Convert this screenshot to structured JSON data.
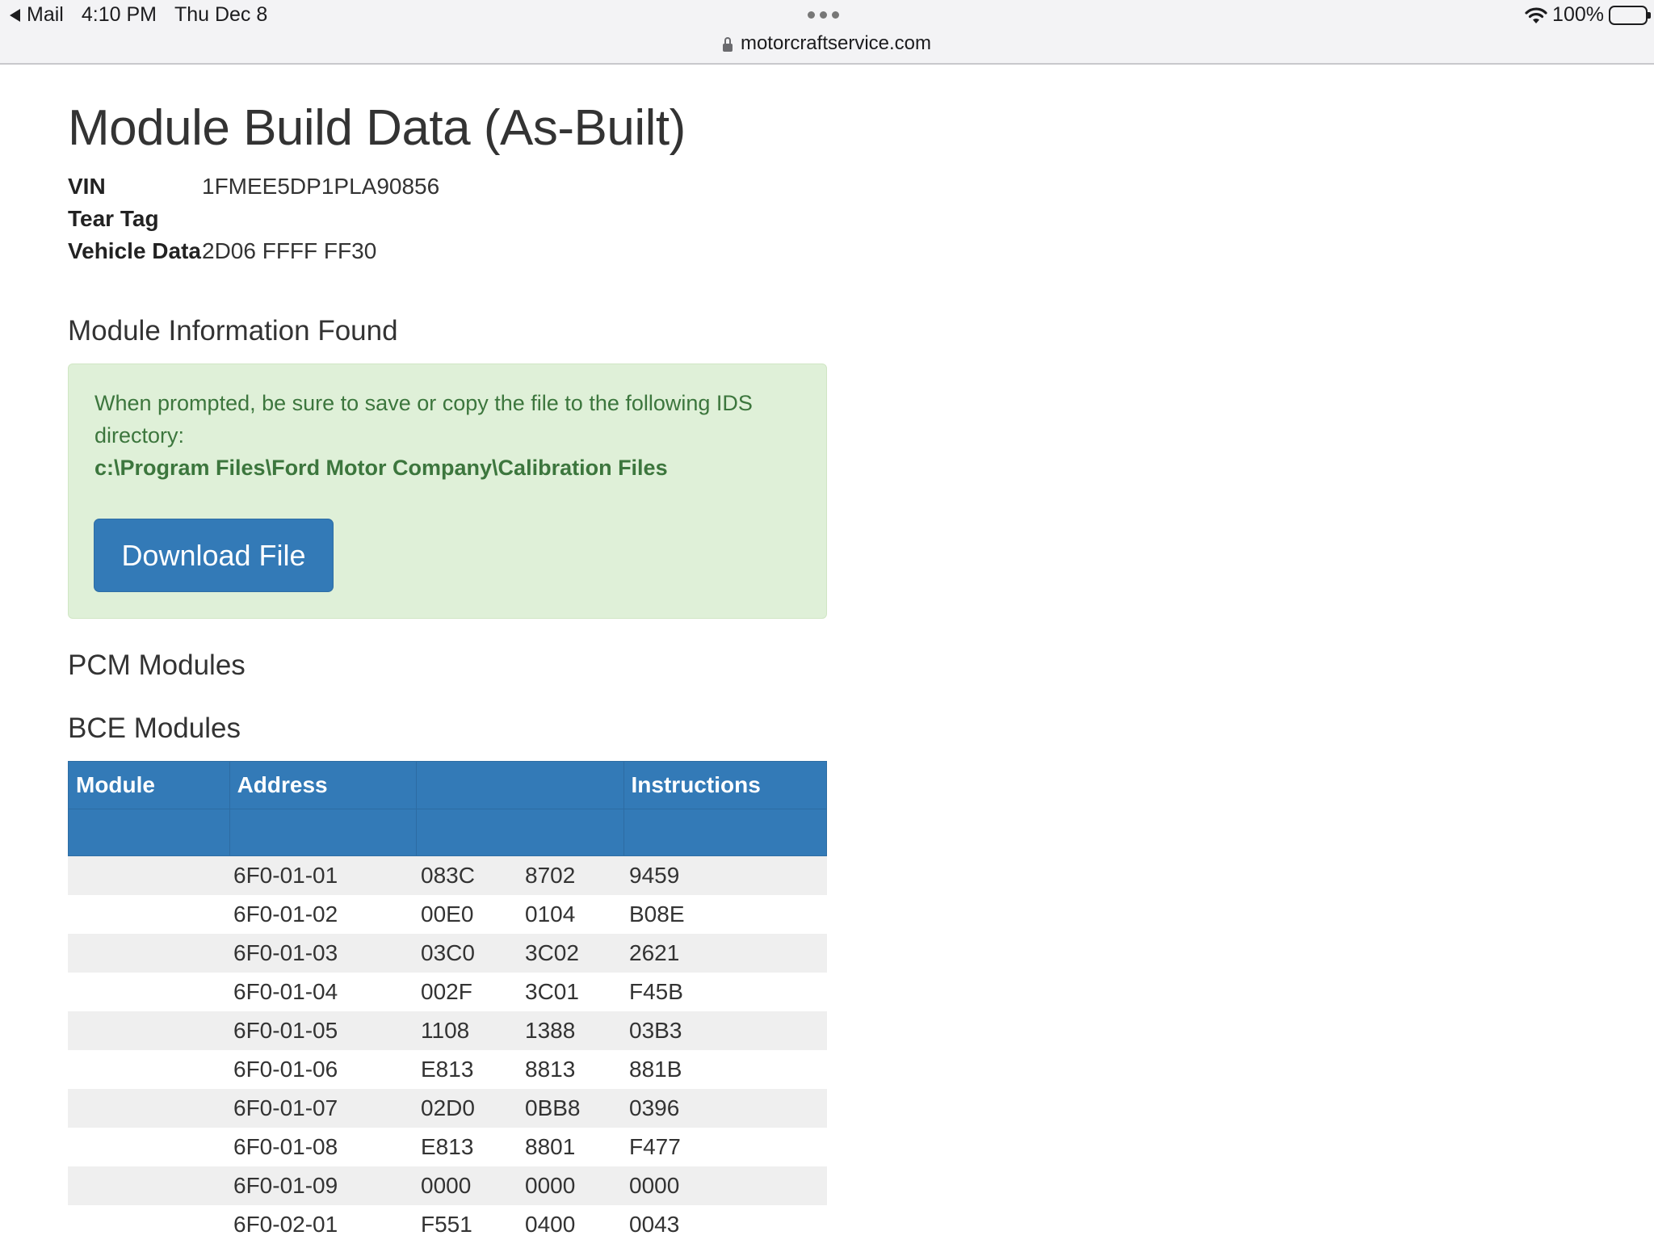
{
  "status_bar": {
    "back_app": "Mail",
    "time": "4:10 PM",
    "date": "Thu Dec 8",
    "battery": "100%",
    "url": "motorcraftservice.com"
  },
  "page": {
    "title": "Module Build Data (As-Built)",
    "vin_label": "VIN",
    "vin_value": "1FMEE5DP1PLA90856",
    "tear_tag_label": "Tear Tag",
    "tear_tag_value": "",
    "vehicle_data_label": "Vehicle Data",
    "vehicle_data_value": "2D06 FFFF FF30"
  },
  "found": {
    "heading": "Module Information Found",
    "message": "When prompted, be sure to save or copy the file to the following IDS directory:",
    "path": "c:\\Program Files\\Ford Motor Company\\Calibration Files",
    "download_label": "Download File"
  },
  "sections": {
    "pcm_heading": "PCM Modules",
    "bce_heading": "BCE Modules"
  },
  "table": {
    "headers": [
      "Module",
      "Address",
      "",
      "Instructions"
    ],
    "rows": [
      {
        "module": "",
        "address": "6F0-01-01",
        "d1": "083C",
        "d2": "8702",
        "d3": "9459"
      },
      {
        "module": "",
        "address": "6F0-01-02",
        "d1": "00E0",
        "d2": "0104",
        "d3": "B08E"
      },
      {
        "module": "",
        "address": "6F0-01-03",
        "d1": "03C0",
        "d2": "3C02",
        "d3": "2621"
      },
      {
        "module": "",
        "address": "6F0-01-04",
        "d1": "002F",
        "d2": "3C01",
        "d3": "F45B"
      },
      {
        "module": "",
        "address": "6F0-01-05",
        "d1": "1108",
        "d2": "1388",
        "d3": "03B3"
      },
      {
        "module": "",
        "address": "6F0-01-06",
        "d1": "E813",
        "d2": "8813",
        "d3": "881B"
      },
      {
        "module": "",
        "address": "6F0-01-07",
        "d1": "02D0",
        "d2": "0BB8",
        "d3": "0396"
      },
      {
        "module": "",
        "address": "6F0-01-08",
        "d1": "E813",
        "d2": "8801",
        "d3": "F477"
      },
      {
        "module": "",
        "address": "6F0-01-09",
        "d1": "0000",
        "d2": "0000",
        "d3": "0000"
      },
      {
        "module": "",
        "address": "6F0-02-01",
        "d1": "F551",
        "d2": "0400",
        "d3": "0043"
      }
    ]
  }
}
